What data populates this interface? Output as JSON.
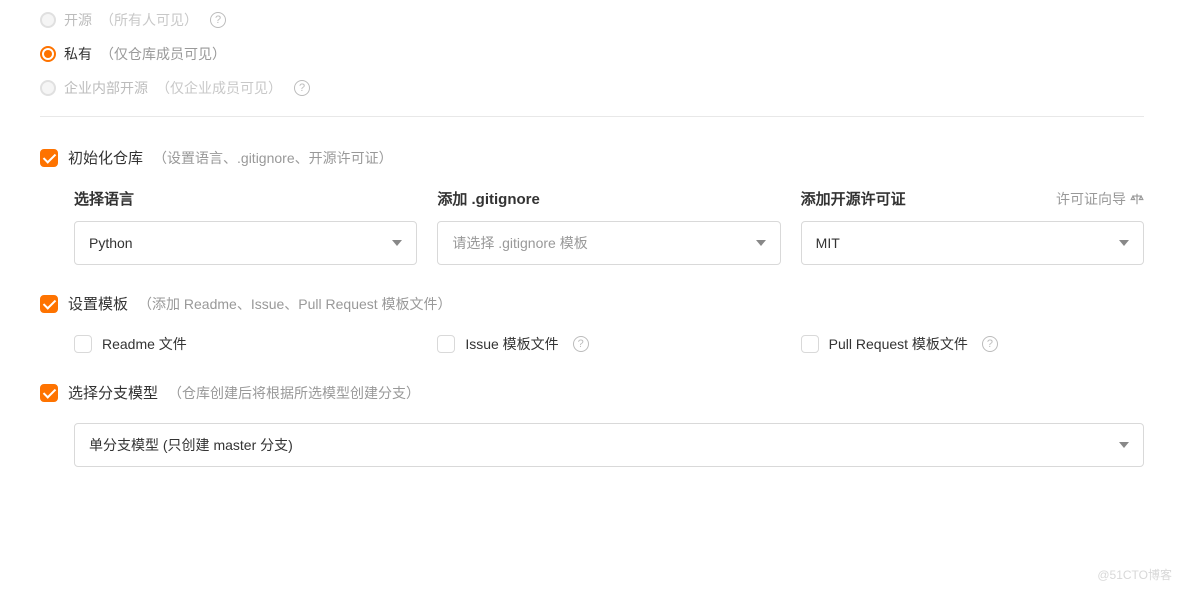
{
  "visibility": {
    "open": {
      "label": "开源",
      "note": "（所有人可见）"
    },
    "private": {
      "label": "私有",
      "note": "（仅仓库成员可见）"
    },
    "enterprise": {
      "label": "企业内部开源",
      "note": "（仅企业成员可见）"
    }
  },
  "init": {
    "title": "初始化仓库",
    "note": "（设置语言、.gitignore、开源许可证）",
    "language": {
      "label": "选择语言",
      "value": "Python"
    },
    "gitignore": {
      "label": "添加 .gitignore",
      "placeholder": "请选择 .gitignore 模板"
    },
    "license": {
      "label": "添加开源许可证",
      "value": "MIT",
      "guide": "许可证向导"
    }
  },
  "template": {
    "title": "设置模板",
    "note": "（添加 Readme、Issue、Pull Request 模板文件）",
    "readme": "Readme 文件",
    "issue": "Issue 模板文件",
    "pr": "Pull Request 模板文件"
  },
  "branch": {
    "title": "选择分支模型",
    "note": "（仓库创建后将根据所选模型创建分支）",
    "value": "单分支模型 (只创建 master 分支)"
  },
  "watermark": "@51CTO博客"
}
